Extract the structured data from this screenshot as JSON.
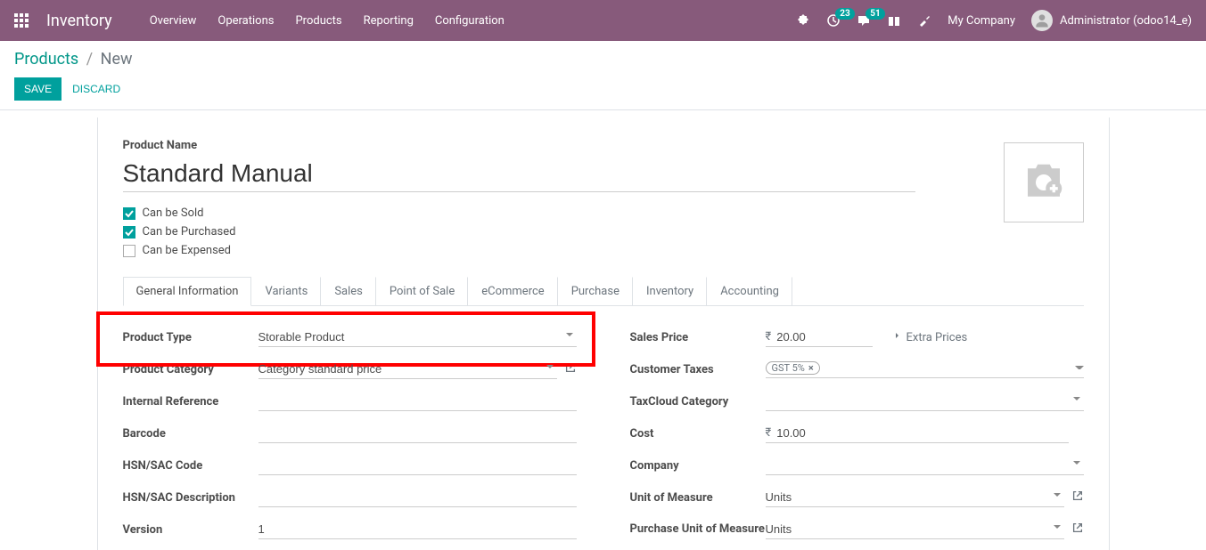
{
  "nav": {
    "brand": "Inventory",
    "menu": [
      "Overview",
      "Operations",
      "Products",
      "Reporting",
      "Configuration"
    ],
    "badge1": "23",
    "badge2": "51",
    "company": "My Company",
    "user": "Administrator (odoo14_e)"
  },
  "breadcrumb": {
    "root": "Products",
    "current": "New"
  },
  "actions": {
    "save": "SAVE",
    "discard": "DISCARD"
  },
  "form": {
    "name_label": "Product Name",
    "name_value": "Standard Manual",
    "checks": {
      "sold": {
        "label": "Can be Sold",
        "checked": true
      },
      "purchased": {
        "label": "Can be Purchased",
        "checked": true
      },
      "expensed": {
        "label": "Can be Expensed",
        "checked": false
      }
    }
  },
  "tabs": [
    "General Information",
    "Variants",
    "Sales",
    "Point of Sale",
    "eCommerce",
    "Purchase",
    "Inventory",
    "Accounting"
  ],
  "left_fields": {
    "product_type": {
      "label": "Product Type",
      "value": "Storable Product"
    },
    "product_category": {
      "label": "Product Category",
      "value": "Category standard price"
    },
    "internal_ref": {
      "label": "Internal Reference",
      "value": ""
    },
    "barcode": {
      "label": "Barcode",
      "value": ""
    },
    "hsn_code": {
      "label": "HSN/SAC Code",
      "value": ""
    },
    "hsn_desc": {
      "label": "HSN/SAC Description",
      "value": ""
    },
    "version": {
      "label": "Version",
      "value": "1"
    }
  },
  "right_fields": {
    "sales_price": {
      "label": "Sales Price",
      "value": "20.00",
      "currency": "₹",
      "extra": "Extra Prices"
    },
    "customer_taxes": {
      "label": "Customer Taxes",
      "tag": "GST 5%"
    },
    "taxcloud": {
      "label": "TaxCloud Category",
      "value": ""
    },
    "cost": {
      "label": "Cost",
      "value": "10.00",
      "currency": "₹"
    },
    "company": {
      "label": "Company",
      "value": ""
    },
    "uom": {
      "label": "Unit of Measure",
      "value": "Units"
    },
    "purchase_uom": {
      "label": "Purchase Unit of Measure",
      "value": "Units"
    }
  }
}
